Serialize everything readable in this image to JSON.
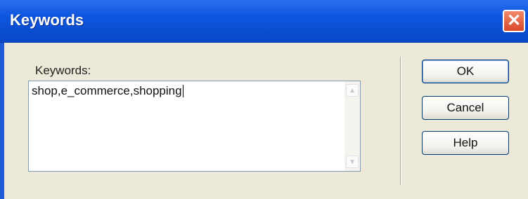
{
  "window": {
    "title": "Keywords",
    "close_icon": "close-icon",
    "close_glyph": "✕"
  },
  "form": {
    "keywords_label": "Keywords:",
    "keywords_value": "shop,e_commerce,shopping"
  },
  "scrollbar": {
    "up_glyph": "▲",
    "down_glyph": "▼"
  },
  "buttons": {
    "ok": "OK",
    "cancel": "Cancel",
    "help": "Help"
  },
  "colors": {
    "titlebar": "#0d55de",
    "client_bg": "#ece9d8",
    "close_button": "#d9472c"
  }
}
